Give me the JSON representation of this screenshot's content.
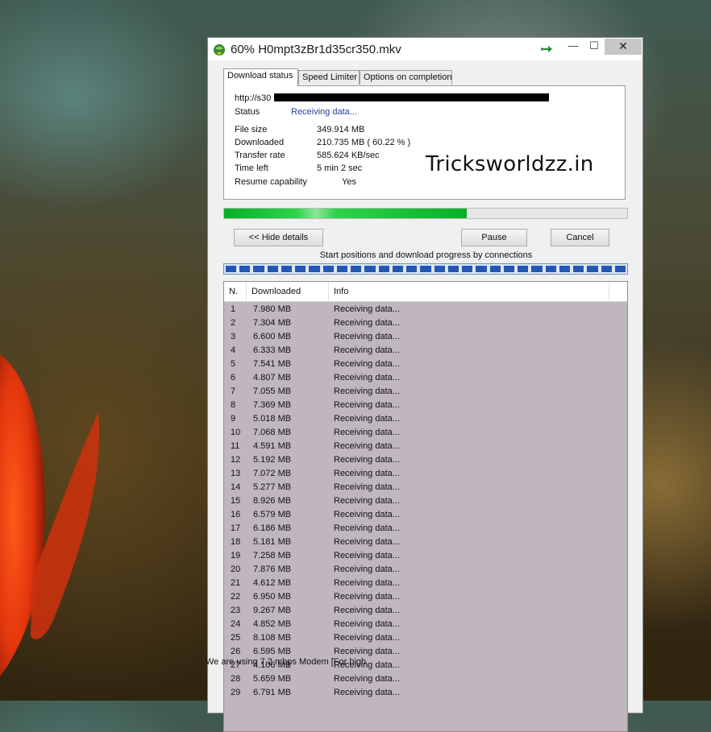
{
  "window": {
    "title": "60% H0mpt3zBr1d35cr350.mkv",
    "minimize_glyph": "—",
    "maximize_glyph": "☐",
    "close_glyph": "✕"
  },
  "tabs": [
    {
      "label": "Download status"
    },
    {
      "label": "Speed Limiter"
    },
    {
      "label": "Options on completion"
    }
  ],
  "status": {
    "url_prefix": "http://s30",
    "status_label": "Status",
    "status_value": "Receiving data...",
    "file_size_label": "File size",
    "file_size_value": "349.914  MB",
    "downloaded_label": "Downloaded",
    "downloaded_value": "210.735  MB  ( 60.22 % )",
    "transfer_rate_label": "Transfer rate",
    "transfer_rate_value": "585.624  KB/sec",
    "time_left_label": "Time left",
    "time_left_value": "5 min 2 sec",
    "resume_label": "Resume capability",
    "resume_value": "Yes",
    "progress_percent": 60.22
  },
  "watermark": "Tricksworldzz.in",
  "buttons": {
    "hide_details": "<< Hide details",
    "pause": "Pause",
    "cancel": "Cancel"
  },
  "connections_caption": "Start positions and download progress by connections",
  "table": {
    "headers": {
      "n": "N.",
      "downloaded": "Downloaded",
      "info": "Info"
    },
    "rows": [
      {
        "n": "1",
        "downloaded": "7.980  MB",
        "info": "Receiving data..."
      },
      {
        "n": "2",
        "downloaded": "7.304  MB",
        "info": "Receiving data..."
      },
      {
        "n": "3",
        "downloaded": "6.600  MB",
        "info": "Receiving data..."
      },
      {
        "n": "4",
        "downloaded": "6.333  MB",
        "info": "Receiving data..."
      },
      {
        "n": "5",
        "downloaded": "7.541  MB",
        "info": "Receiving data..."
      },
      {
        "n": "6",
        "downloaded": "4.807  MB",
        "info": "Receiving data..."
      },
      {
        "n": "7",
        "downloaded": "7.055  MB",
        "info": "Receiving data..."
      },
      {
        "n": "8",
        "downloaded": "7.369  MB",
        "info": "Receiving data..."
      },
      {
        "n": "9",
        "downloaded": "5.018  MB",
        "info": "Receiving data..."
      },
      {
        "n": "10",
        "downloaded": "7.068  MB",
        "info": "Receiving data..."
      },
      {
        "n": "11",
        "downloaded": "4.591  MB",
        "info": "Receiving data..."
      },
      {
        "n": "12",
        "downloaded": "5.192  MB",
        "info": "Receiving data..."
      },
      {
        "n": "13",
        "downloaded": "7.072  MB",
        "info": "Receiving data..."
      },
      {
        "n": "14",
        "downloaded": "5.277  MB",
        "info": "Receiving data..."
      },
      {
        "n": "15",
        "downloaded": "8.926  MB",
        "info": "Receiving data..."
      },
      {
        "n": "16",
        "downloaded": "6.579  MB",
        "info": "Receiving data..."
      },
      {
        "n": "17",
        "downloaded": "6.186  MB",
        "info": "Receiving data..."
      },
      {
        "n": "18",
        "downloaded": "5.181  MB",
        "info": "Receiving data..."
      },
      {
        "n": "19",
        "downloaded": "7.258  MB",
        "info": "Receiving data..."
      },
      {
        "n": "20",
        "downloaded": "7.876  MB",
        "info": "Receiving data..."
      },
      {
        "n": "21",
        "downloaded": "4.612  MB",
        "info": "Receiving data..."
      },
      {
        "n": "22",
        "downloaded": "6.950  MB",
        "info": "Receiving data..."
      },
      {
        "n": "23",
        "downloaded": "9.267  MB",
        "info": "Receiving data..."
      },
      {
        "n": "24",
        "downloaded": "4.852  MB",
        "info": "Receiving data..."
      },
      {
        "n": "25",
        "downloaded": "8.108  MB",
        "info": "Receiving data..."
      },
      {
        "n": "26",
        "downloaded": "6.595  MB",
        "info": "Receiving data..."
      },
      {
        "n": "27",
        "downloaded": "4.106  MB",
        "info": "Receiving data..."
      },
      {
        "n": "28",
        "downloaded": "5.659  MB",
        "info": "Receiving data..."
      },
      {
        "n": "29",
        "downloaded": "6.791  MB",
        "info": "Receiving data..."
      }
    ]
  },
  "bottom_caption": "We are using 7.2 mbps Modem [For high",
  "colors": {
    "progress_green": "#06b025",
    "connection_blue": "#2456b8",
    "list_background": "#c0b6bf",
    "status_link": "#1f3fa0"
  }
}
